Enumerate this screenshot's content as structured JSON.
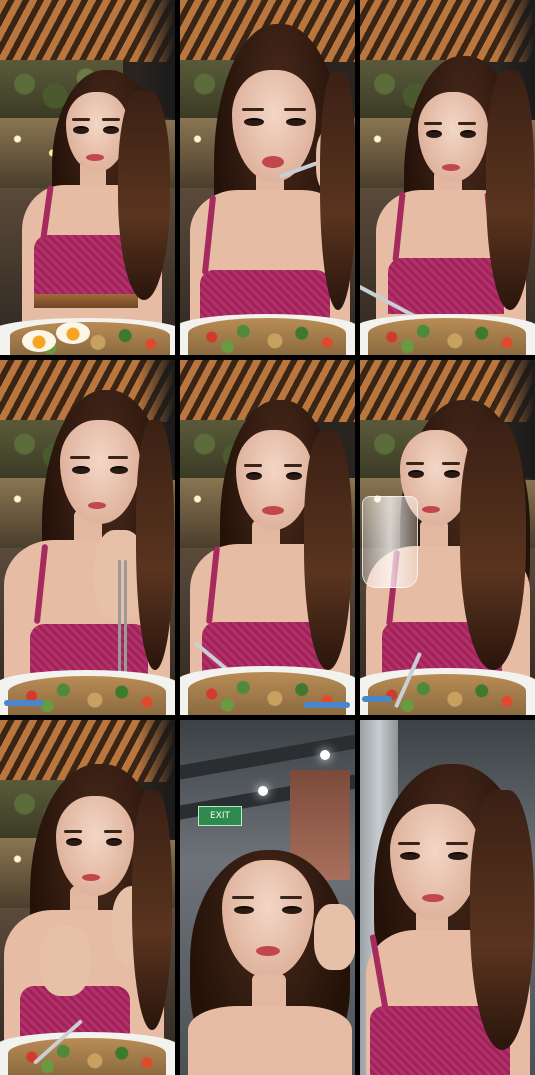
{
  "image": {
    "type": "photo-collage",
    "layout": "3x3 grid",
    "frame_count": 9
  },
  "frames": [
    {
      "index": 1,
      "scene": "restaurant",
      "action": "looking-away",
      "has_egg_plate": true
    },
    {
      "index": 2,
      "scene": "restaurant",
      "action": "eating-with-fork"
    },
    {
      "index": 3,
      "scene": "restaurant",
      "action": "holding-fork"
    },
    {
      "index": 4,
      "scene": "restaurant",
      "action": "holding-chopsticks"
    },
    {
      "index": 5,
      "scene": "restaurant",
      "action": "smiling"
    },
    {
      "index": 6,
      "scene": "restaurant",
      "action": "drinking-from-cup"
    },
    {
      "index": 7,
      "scene": "restaurant",
      "action": "eating-snack"
    },
    {
      "index": 8,
      "scene": "parking-garage",
      "action": "talking",
      "sign_text": "EXIT"
    },
    {
      "index": 9,
      "scene": "parking-garage",
      "action": "posing"
    }
  ],
  "colors": {
    "background": "#000000",
    "top_pink": "#b5306a",
    "ceiling_wood": "#b9773f",
    "hair": "#3a2014"
  }
}
